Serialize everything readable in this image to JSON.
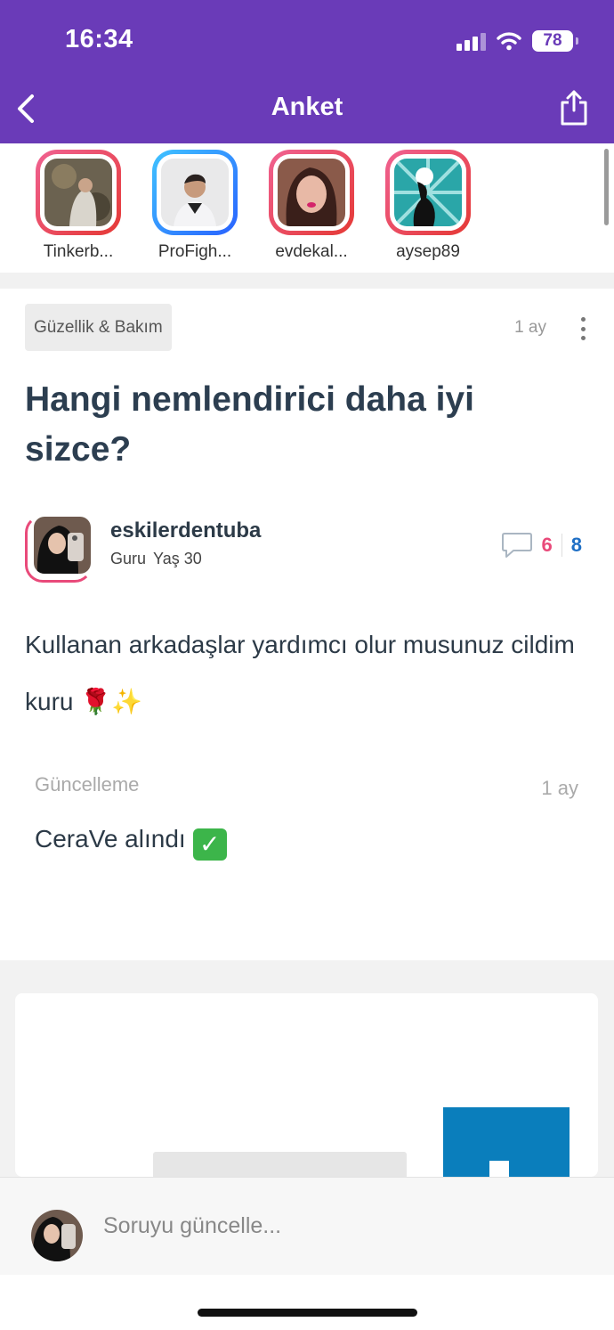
{
  "status_bar": {
    "time": "16:34",
    "battery": "78"
  },
  "nav": {
    "title": "Anket",
    "back_icon": "chevron-left-icon",
    "share_icon": "share-icon"
  },
  "stories": [
    {
      "name": "Tinkerb...",
      "ring": [
        "#f06292",
        "#e53935"
      ]
    },
    {
      "name": "ProFigh...",
      "ring": [
        "#40c4ff",
        "#2962ff"
      ]
    },
    {
      "name": "evdekal...",
      "ring": [
        "#f06292",
        "#e53935"
      ]
    },
    {
      "name": "aysep89",
      "ring": [
        "#f06292",
        "#e53935"
      ]
    }
  ],
  "post": {
    "category": "Güzellik & Bakım",
    "time": "1 ay",
    "title": "Hangi nemlendirici daha iyi sizce?",
    "author": {
      "username": "eskilerdentuba",
      "level": "Guru",
      "age": "Yaş 30"
    },
    "counts": {
      "pink": "6",
      "blue": "8"
    },
    "body": "Kullanan arkadaşlar yardımcı olur musunuz cildim kuru 🌹✨",
    "update": {
      "label": "Güncelleme",
      "time": "1 ay",
      "text": "CeraVe alındı"
    }
  },
  "composer": {
    "placeholder": "Soruyu güncelle..."
  },
  "colors": {
    "header": "#6a3bb8",
    "pink": "#e94a7a",
    "blue": "#1f6fc5"
  }
}
